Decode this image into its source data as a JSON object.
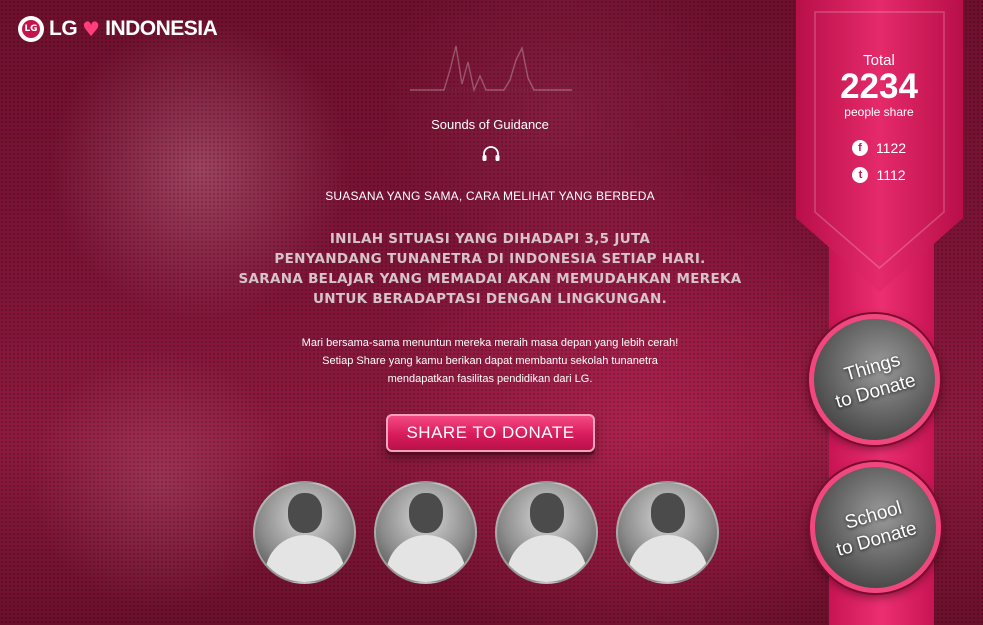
{
  "brand": {
    "logo_mark": "LG",
    "name": "LG",
    "country": "INDONESIA",
    "accent": "#e01f60"
  },
  "campaign": {
    "title": "Sounds of Guidance",
    "tagline": "SUASANA YANG SAMA, CARA MELIHAT YANG BERBEDA",
    "situation_lines": [
      "INILAH SITUASI YANG DIHADAPI 3,5 JUTA",
      "PENYANDANG TUNANETRA DI INDONESIA SETIAP HARI.",
      "SARANA BELAJAR YANG MEMADAI AKAN MEMUDAHKAN MEREKA",
      "UNTUK BERADAPTASI DENGAN LINGKUNGAN."
    ],
    "invite_lines": [
      "Mari bersama-sama menuntun mereka meraih masa depan yang lebih cerah!",
      "Setiap Share yang kamu berikan dapat membantu sekolah tunanetra",
      "mendapatkan fasilitas pendidikan dari LG."
    ],
    "share_button": "SHARE TO DONATE"
  },
  "stats": {
    "total_label": "Total",
    "total_count": "2234",
    "total_caption": "people share",
    "facebook_icon": "f",
    "facebook_count": "1122",
    "twitter_icon": "t",
    "twitter_count": "1112"
  },
  "side_buttons": {
    "things_line1": "Things",
    "things_line2": "to Donate",
    "school_line1": "School",
    "school_line2": "to Donate"
  },
  "icons": [
    "lg-logo-icon",
    "heart-icon",
    "waveform-icon",
    "headphones-icon",
    "facebook-icon",
    "twitter-icon"
  ]
}
